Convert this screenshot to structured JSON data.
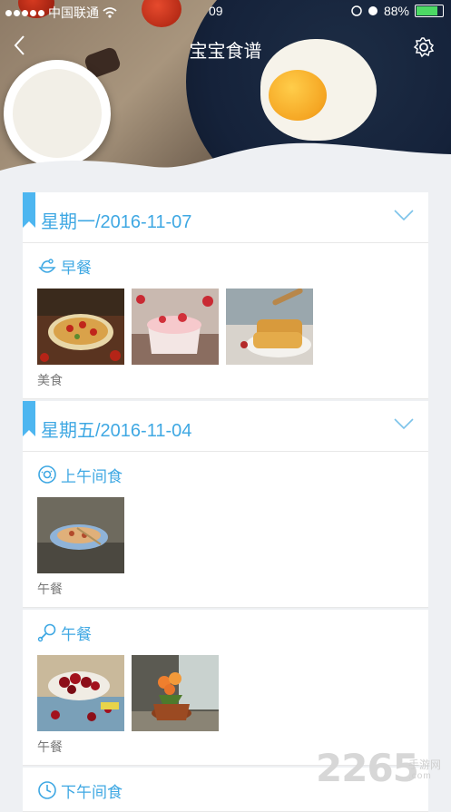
{
  "status_bar": {
    "carrier": "中国联通",
    "time": "09",
    "battery_pct": "88%",
    "battery_level": 0.88
  },
  "nav": {
    "title": "宝宝食谱"
  },
  "colors": {
    "accent": "#3fa8e3",
    "ribbon": "#4db6f0"
  },
  "days": [
    {
      "date": "星期一/2016-11-07",
      "meals": [
        {
          "name": "早餐",
          "icon": "bowl-icon",
          "note": "美食"
        }
      ]
    },
    {
      "date": "星期五/2016-11-04",
      "meals": [
        {
          "name": "上午间食",
          "icon": "donut-icon",
          "note": "午餐"
        },
        {
          "name": "午餐",
          "icon": "drumstick-icon",
          "note": "午餐"
        },
        {
          "name": "下午间食",
          "icon": "clock-icon",
          "note": ""
        }
      ]
    }
  ],
  "watermark": {
    "number": "2265",
    "cn": "手游网",
    "en": ".com"
  }
}
